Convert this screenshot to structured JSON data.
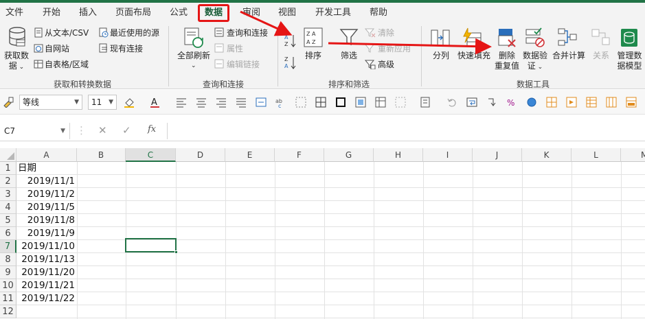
{
  "menu_tabs": [
    "文件",
    "开始",
    "插入",
    "页面布局",
    "公式",
    "数据",
    "审阅",
    "视图",
    "开发工具",
    "帮助"
  ],
  "active_tab": "数据",
  "ribbon": {
    "get_data": {
      "label_line1": "获取数",
      "label_line2": "据"
    },
    "from_text_csv": "从文本/CSV",
    "from_web": "自网站",
    "from_table": "自表格/区域",
    "recent_sources": "最近使用的源",
    "existing_connections": "现有连接",
    "group_get_transform": "获取和转换数据",
    "refresh_all": "全部刷新",
    "queries_connections": "查询和连接",
    "properties": "属性",
    "edit_links": "编辑链接",
    "group_queries": "查询和连接",
    "sort": "排序",
    "filter": "筛选",
    "clear": "清除",
    "reapply": "重新应用",
    "advanced": "高级",
    "group_sort_filter": "排序和筛选",
    "text_to_columns": "分列",
    "flash_fill": "快速填充",
    "remove_duplicates_line1": "删除",
    "remove_duplicates_line2": "重复值",
    "data_validation_line1": "数据验",
    "data_validation_line2": "证",
    "consolidate": "合并计算",
    "relationships": "关系",
    "manage_model_line1": "管理数",
    "manage_model_line2": "据模型",
    "group_data_tools": "数据工具"
  },
  "format_bar": {
    "font_name": "等线",
    "font_size": "11"
  },
  "formula_bar": {
    "name_box": "C7",
    "cancel": "✕",
    "enter": "✓",
    "fx": "fx",
    "value": ""
  },
  "grid": {
    "columns": [
      "A",
      "B",
      "C",
      "D",
      "E",
      "F",
      "G",
      "H",
      "I",
      "J",
      "K",
      "L",
      "M"
    ],
    "rows": [
      "1",
      "2",
      "3",
      "4",
      "5",
      "6",
      "7",
      "8",
      "9",
      "10",
      "11",
      "12"
    ],
    "selected_cell": "C7",
    "a_header": "日期",
    "a_values": [
      "2019/11/1",
      "2019/11/2",
      "2019/11/5",
      "2019/11/8",
      "2019/11/9",
      "2019/11/10",
      "2019/11/13",
      "2019/11/20",
      "2019/11/21",
      "2019/11/22"
    ]
  },
  "colors": {
    "accent": "#217346",
    "annotation": "#e51515"
  }
}
